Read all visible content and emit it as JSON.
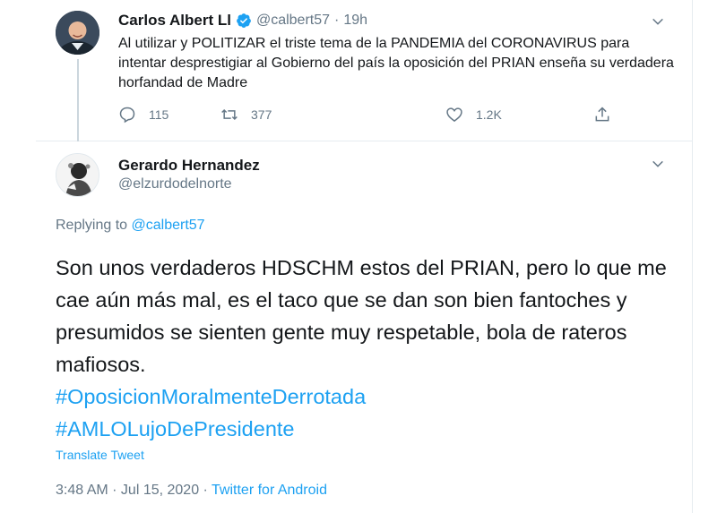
{
  "parent_tweet": {
    "author_name": "Carlos Albert Ll",
    "handle": "@calbert57",
    "separator": "·",
    "time": "19h",
    "text": "Al utilizar y POLITIZAR el triste tema de la PANDEMIA del CORONAVIRUS para intentar desprestigiar al Gobierno del país la oposición del PRIAN enseña su verdadera horfandad de Madre",
    "reply_count": "115",
    "retweet_count": "377",
    "like_count": "1.2K"
  },
  "reply_tweet": {
    "author_name": "Gerardo Hernandez",
    "handle": "@elzurdodelnorte",
    "replying_prefix": "Replying to",
    "replying_to": "@calbert57",
    "text": "Son unos verdaderos HDSCHM estos del PRIAN, pero lo que me cae aún más mal, es el taco que se dan son bien fantoches y presumidos se sienten gente muy respetable, bola de rateros mafiosos.",
    "hashtags": [
      "#OposicionMoralmenteDerrotada",
      "#AMLOLujoDePresidente"
    ],
    "translate_label": "Translate Tweet",
    "timestamp": "3:48 AM · Jul 15, 2020 ·",
    "source": "Twitter for Android"
  },
  "icons": {
    "verified": "verified-badge-icon",
    "reply": "reply-icon",
    "retweet": "retweet-icon",
    "like": "like-icon",
    "share": "share-icon",
    "more": "chevron-down-icon"
  },
  "colors": {
    "accent": "#1da1f2",
    "secondary_text": "#657786",
    "primary_text": "#14171a",
    "divider": "#e6ecf0"
  }
}
